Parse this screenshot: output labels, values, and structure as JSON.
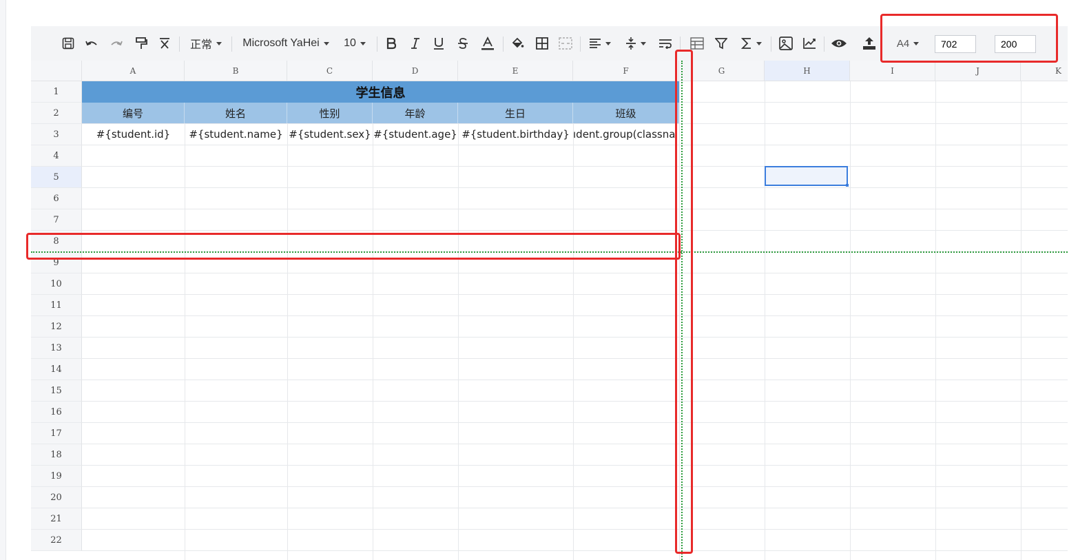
{
  "toolbar": {
    "style_label": "正常",
    "font_label": "Microsoft YaHei",
    "size_label": "10",
    "paper_label": "A4",
    "width_value": "702",
    "height_value": "200"
  },
  "sheet": {
    "columns": [
      "A",
      "B",
      "C",
      "D",
      "E",
      "F",
      "G",
      "H",
      "I",
      "J",
      "K"
    ],
    "rows": [
      "1",
      "2",
      "3",
      "4",
      "5",
      "6",
      "7",
      "8",
      "9",
      "10",
      "11",
      "12",
      "13",
      "14",
      "15",
      "16",
      "17",
      "18",
      "19",
      "20",
      "21",
      "22"
    ],
    "title": "学生信息",
    "headers": [
      "编号",
      "姓名",
      "性别",
      "年龄",
      "生日",
      "班级"
    ],
    "data_row": [
      "#{student.id}",
      "#{student.name}",
      "#{student.sex}",
      "#{student.age}",
      "#{student.birthday}",
      "ıdent.group(classna"
    ]
  },
  "colors": {
    "title_bg": "#5b9bd5",
    "header_bg": "#9dc3e6",
    "selection": "#3b7ddd",
    "highlight_box": "#e82a2a",
    "page_break": "#2a9a3a"
  }
}
